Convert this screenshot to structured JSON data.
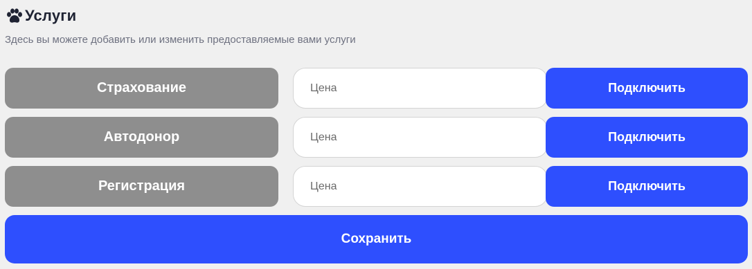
{
  "header": {
    "icon": "paw-icon",
    "title": "Услуги",
    "subtitle": "Здесь вы можете добавить или изменить предоставляемые вами услуги"
  },
  "services": [
    {
      "name": "Страхование",
      "price_placeholder": "Цена",
      "price_value": "",
      "connect_label": "Подключить"
    },
    {
      "name": "Автодонор",
      "price_placeholder": "Цена",
      "price_value": "",
      "connect_label": "Подключить"
    },
    {
      "name": "Регистрация",
      "price_placeholder": "Цена",
      "price_value": "",
      "connect_label": "Подключить"
    }
  ],
  "save_label": "Сохранить",
  "colors": {
    "background": "#f0f0f0",
    "service_bg": "#8e8e8e",
    "accent": "#2e4ffe",
    "title": "#1f2333",
    "subtitle": "#6e7180"
  }
}
